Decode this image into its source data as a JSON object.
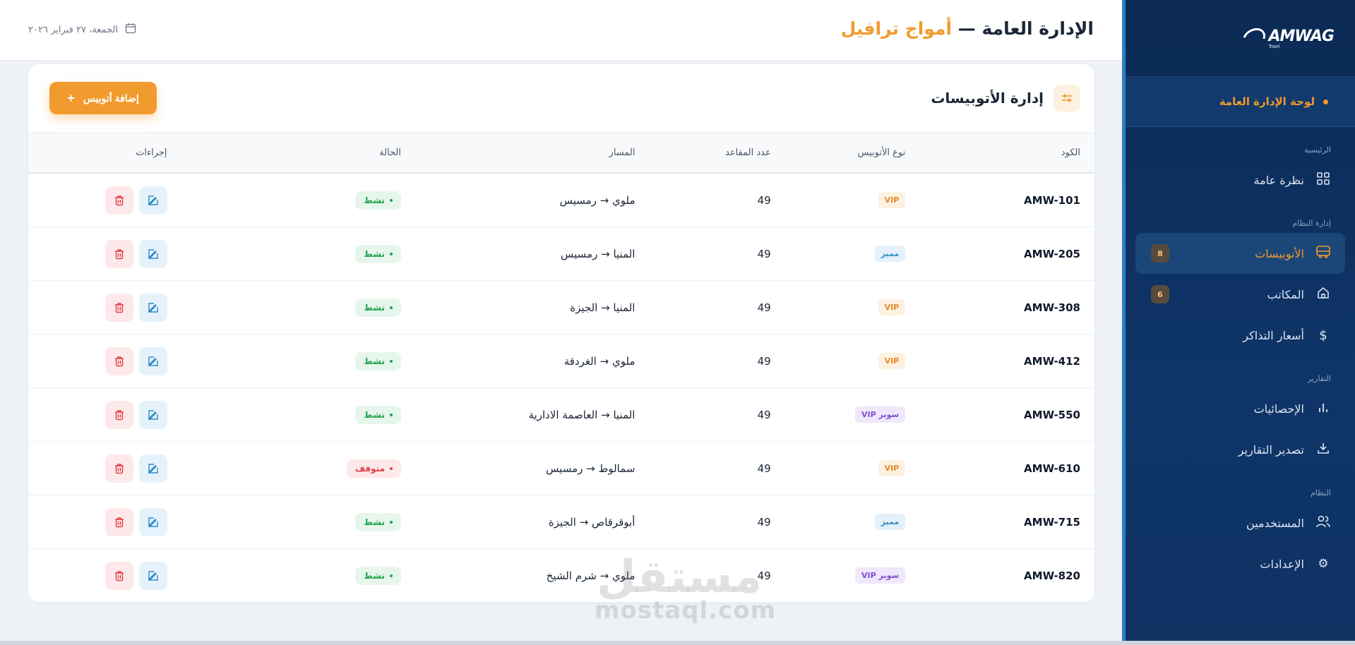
{
  "sidebar": {
    "logo_text": "AMWAG",
    "logo_sub": "Travel",
    "dashboard_label": "لوحة الإدارة العامة",
    "sections": {
      "main": "الرئيسية",
      "system_mgmt": "إدارة النظام",
      "reports": "التقارير",
      "system": "النظام"
    },
    "items": {
      "overview": "نظرة عامة",
      "buses": "الأتوبيسات",
      "buses_badge": "8",
      "offices": "المكاتب",
      "offices_badge": "6",
      "ticket_prices": "أسعار التذاكر",
      "statistics": "الإحصائيات",
      "export_reports": "تصدير التقارير",
      "users": "المستخدمين",
      "settings": "الإعدادات"
    },
    "colors": {
      "bg": "#0b2a55",
      "accent": "#f19a2d"
    }
  },
  "header": {
    "title_main": "الإدارة العامة —",
    "title_accent": "أمواج ترافيل",
    "date": "الجمعة، ٢٧ فبراير ٢٠٢٦"
  },
  "card": {
    "title": "إدارة الأتوبيسات",
    "add_button": "إضافة أتوبيس",
    "columns": {
      "code": "الكود",
      "type": "نوع الأتوبيس",
      "seats": "عدد المقاعد",
      "route": "المسار",
      "status": "الحالة",
      "actions": "إجراءات"
    },
    "rows": [
      {
        "code": "AMW-101",
        "type": "VIP",
        "type_class": "vip",
        "seats": "49",
        "route": "ملوي → رمسيس",
        "status": "نشط",
        "status_class": "ok"
      },
      {
        "code": "AMW-205",
        "type": "مميز",
        "type_class": "mumayyaz",
        "seats": "49",
        "route": "المنيا → رمسيس",
        "status": "نشط",
        "status_class": "ok"
      },
      {
        "code": "AMW-308",
        "type": "VIP",
        "type_class": "vip",
        "seats": "49",
        "route": "المنيا → الجيزة",
        "status": "نشط",
        "status_class": "ok"
      },
      {
        "code": "AMW-412",
        "type": "VIP",
        "type_class": "vip",
        "seats": "49",
        "route": "ملوي → الغردقة",
        "status": "نشط",
        "status_class": "ok"
      },
      {
        "code": "AMW-550",
        "type": "سوبر VIP",
        "type_class": "supervip",
        "seats": "49",
        "route": "المنيا → العاصمة الادارية",
        "status": "نشط",
        "status_class": "ok"
      },
      {
        "code": "AMW-610",
        "type": "VIP",
        "type_class": "vip",
        "seats": "49",
        "route": "سمالوط → رمسيس",
        "status": "متوقف",
        "status_class": "stop"
      },
      {
        "code": "AMW-715",
        "type": "مميز",
        "type_class": "mumayyaz",
        "seats": "49",
        "route": "أبوقرقاص → الجيزة",
        "status": "نشط",
        "status_class": "ok"
      },
      {
        "code": "AMW-820",
        "type": "سوبر VIP",
        "type_class": "supervip",
        "seats": "49",
        "route": "ملوي → شرم الشيخ",
        "status": "نشط",
        "status_class": "ok"
      }
    ]
  },
  "watermark": {
    "arabic": "مستقل",
    "latin": "mostaql.com"
  }
}
